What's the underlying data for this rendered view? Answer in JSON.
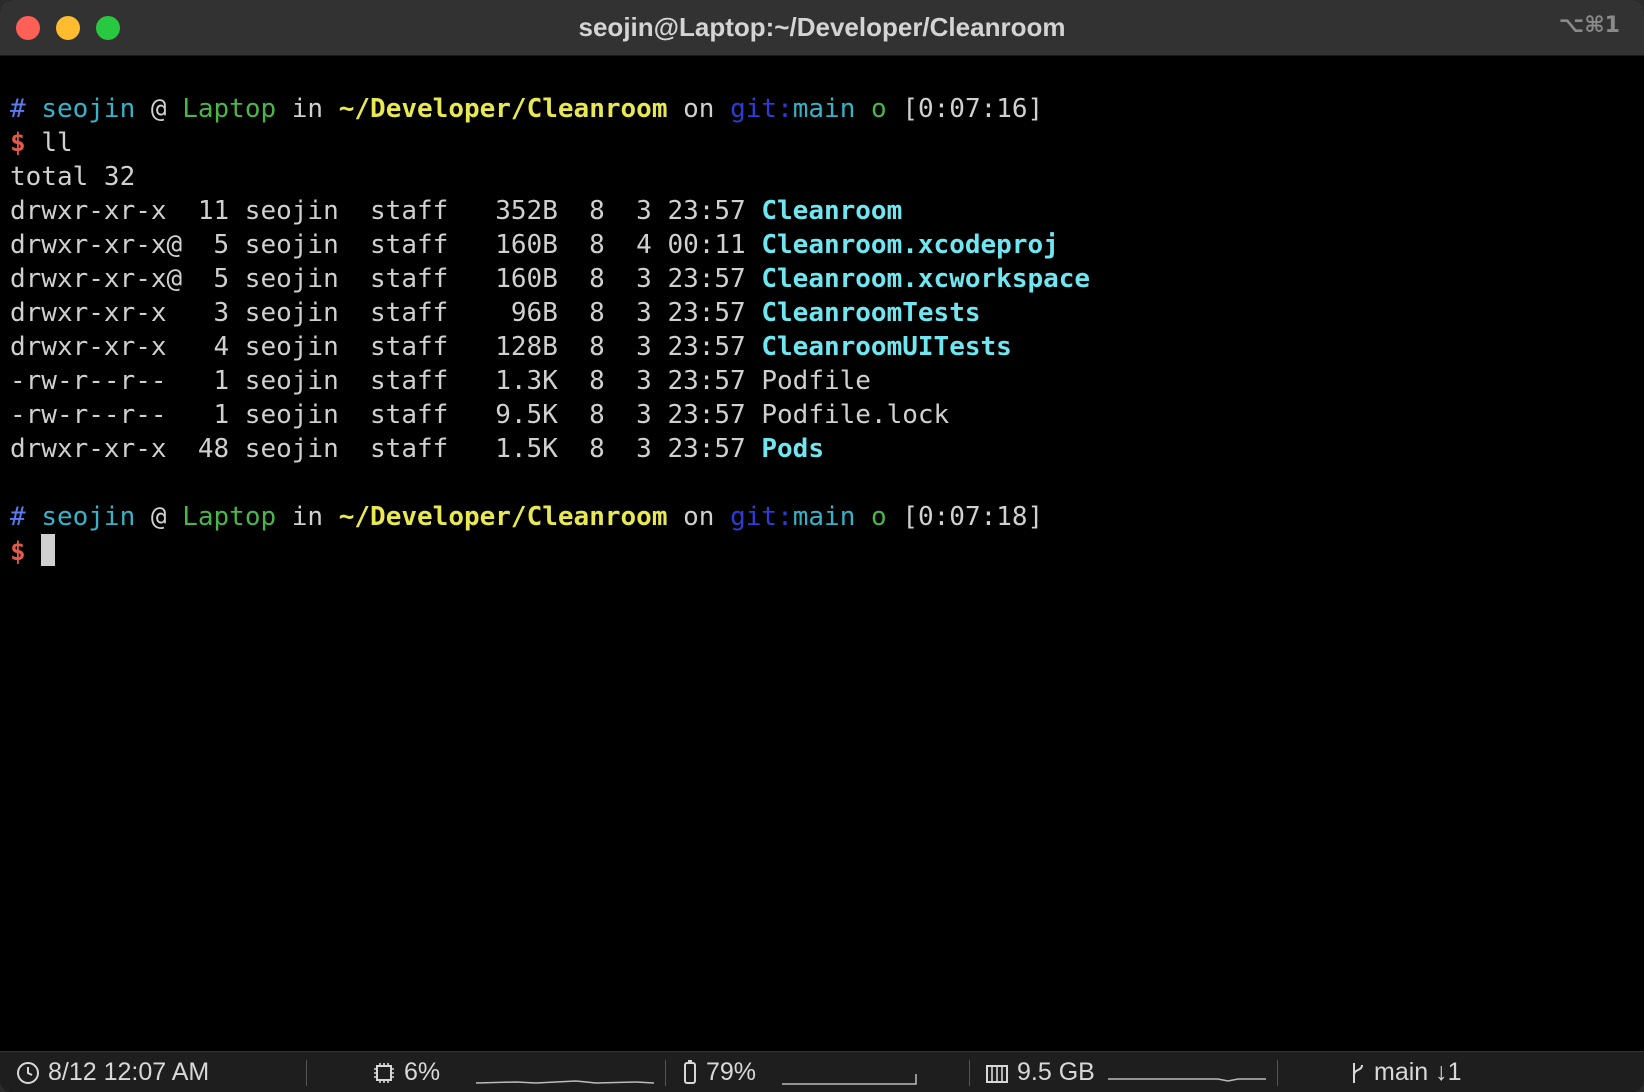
{
  "window": {
    "title": "seojin@Laptop:~/Developer/Cleanroom",
    "shortcut": "⌥⌘1"
  },
  "prompt1": {
    "hash": "#",
    "user": "seojin",
    "at": "@",
    "host": "Laptop",
    "in": "in",
    "path": "~/Developer/Cleanroom",
    "on": "on",
    "git_label": "git:",
    "branch": "main",
    "status": "o",
    "time": "[0:07:16]"
  },
  "command1": {
    "dollar": "$",
    "cmd": "ll"
  },
  "listing": {
    "total": "total 32",
    "rows": [
      {
        "meta": "drwxr-xr-x  11 seojin  staff   352B  8  3 23:57 ",
        "name": "Cleanroom",
        "is_dir": true
      },
      {
        "meta": "drwxr-xr-x@  5 seojin  staff   160B  8  4 00:11 ",
        "name": "Cleanroom.xcodeproj",
        "is_dir": true
      },
      {
        "meta": "drwxr-xr-x@  5 seojin  staff   160B  8  3 23:57 ",
        "name": "Cleanroom.xcworkspace",
        "is_dir": true
      },
      {
        "meta": "drwxr-xr-x   3 seojin  staff    96B  8  3 23:57 ",
        "name": "CleanroomTests",
        "is_dir": true
      },
      {
        "meta": "drwxr-xr-x   4 seojin  staff   128B  8  3 23:57 ",
        "name": "CleanroomUITests",
        "is_dir": true
      },
      {
        "meta": "-rw-r--r--   1 seojin  staff   1.3K  8  3 23:57 ",
        "name": "Podfile",
        "is_dir": false
      },
      {
        "meta": "-rw-r--r--   1 seojin  staff   9.5K  8  3 23:57 ",
        "name": "Podfile.lock",
        "is_dir": false
      },
      {
        "meta": "drwxr-xr-x  48 seojin  staff   1.5K  8  3 23:57 ",
        "name": "Pods",
        "is_dir": true
      }
    ]
  },
  "prompt2": {
    "hash": "#",
    "user": "seojin",
    "at": "@",
    "host": "Laptop",
    "in": "in",
    "path": "~/Developer/Cleanroom",
    "on": "on",
    "git_label": "git:",
    "branch": "main",
    "status": "o",
    "time": "[0:07:18]"
  },
  "command2": {
    "dollar": "$"
  },
  "statusbar": {
    "clock": "8/12 12:07 AM",
    "cpu": "6%",
    "battery": "79%",
    "memory": "9.5 GB",
    "git_branch": "main",
    "git_behind": "↓1"
  },
  "icons": {
    "clock": "clock-icon",
    "cpu": "cpu-icon",
    "battery": "battery-icon",
    "memory": "memory-icon",
    "branch": "git-branch-icon"
  }
}
